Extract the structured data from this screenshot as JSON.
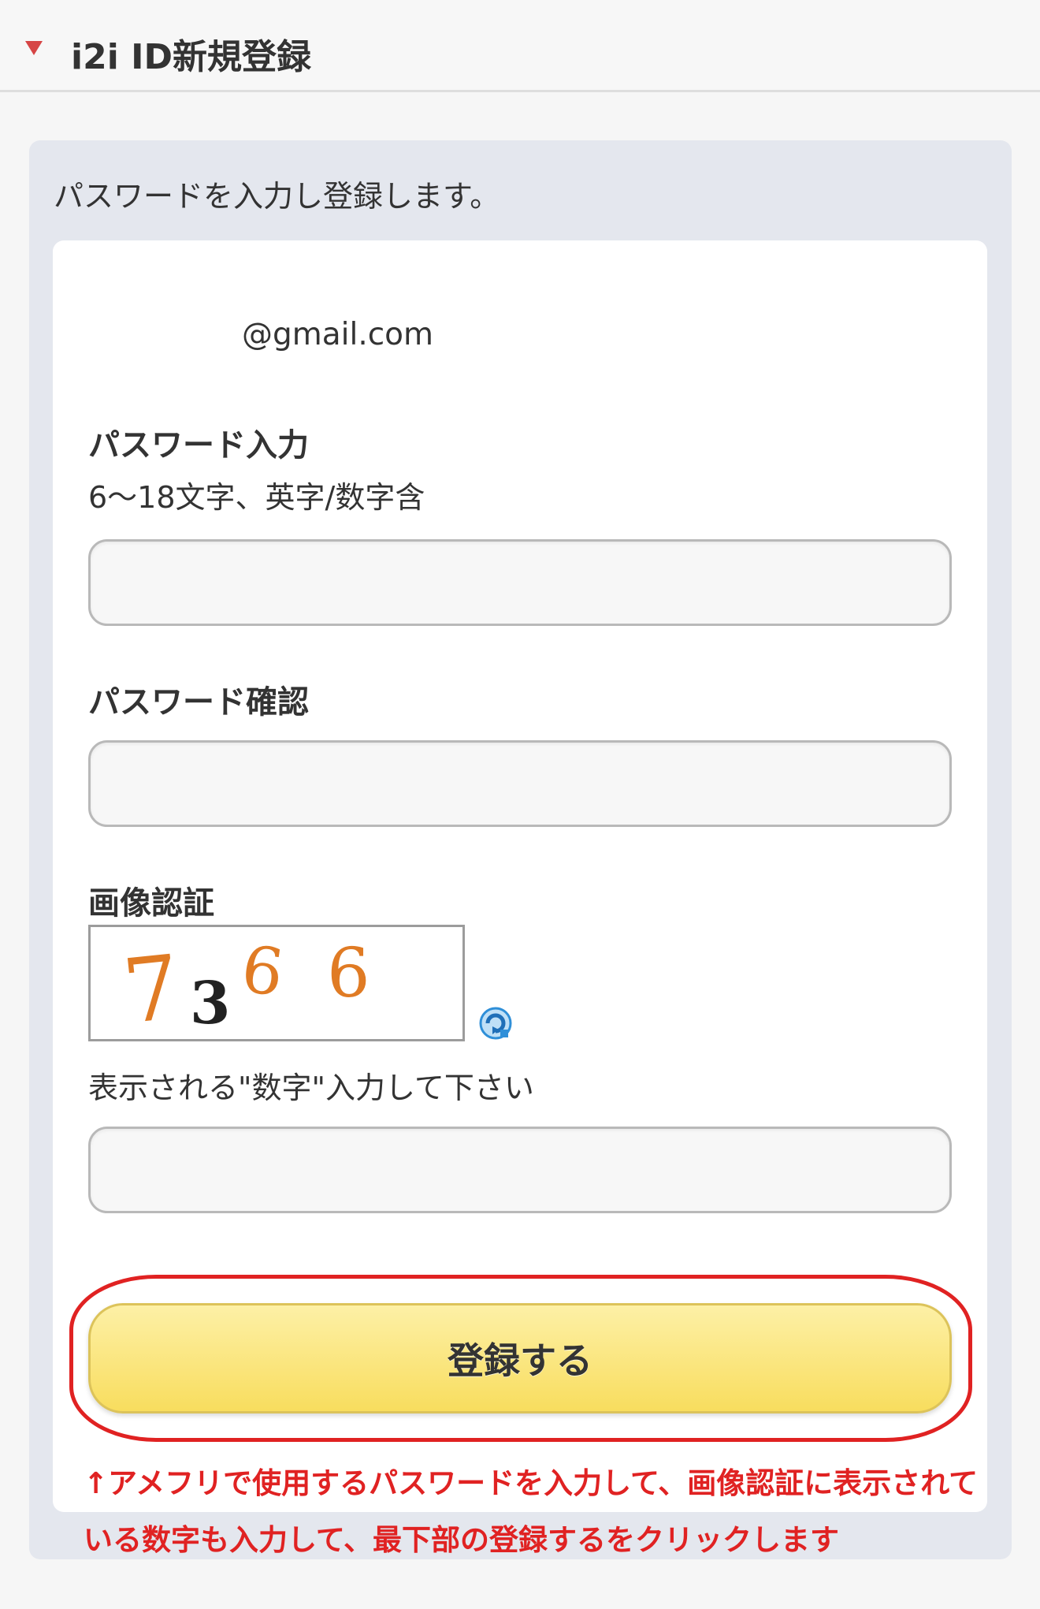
{
  "header": {
    "title": "i2i ID新規登録"
  },
  "panel": {
    "intro": "パスワードを入力し登録します。"
  },
  "account": {
    "email": "@gmail.com"
  },
  "password": {
    "label": "パスワード入力",
    "hint": "6〜18文字、英字/数字含",
    "value": "",
    "placeholder": ""
  },
  "password_confirm": {
    "label": "パスワード確認",
    "value": "",
    "placeholder": ""
  },
  "captcha": {
    "label": "画像認証",
    "digits": [
      "7",
      "3",
      "6",
      "6"
    ],
    "digit_colors": [
      "#e07b24",
      "#222222",
      "#e07b24",
      "#e07b24"
    ],
    "hint": "表示される\"数字\"入力して下さい",
    "value": "",
    "placeholder": ""
  },
  "submit": {
    "label": "登録する"
  },
  "annotation": {
    "text": "↑アメフリで使用するパスワードを入力して、画像認証に表示されている数字も入力して、最下部の登録するをクリックします",
    "color": "#e02222"
  },
  "colors": {
    "accent_red": "#d64545",
    "button_yellow": "#f8dd5e",
    "panel_bg": "#e4e7ee",
    "refresh_blue": "#2f8fd8"
  },
  "icons": {
    "header_marker": "triangle-down-icon",
    "captcha_refresh": "refresh-icon"
  }
}
